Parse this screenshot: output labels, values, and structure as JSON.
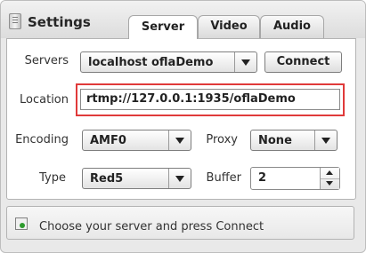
{
  "header": {
    "title": "Settings",
    "tabs": [
      {
        "label": "Server",
        "active": true
      },
      {
        "label": "Video",
        "active": false
      },
      {
        "label": "Audio",
        "active": false
      }
    ]
  },
  "form": {
    "servers_label": "Servers",
    "servers_value": "localhost oflaDemo",
    "connect_label": "Connect",
    "location_label": "Location",
    "location_value": "rtmp://127.0.0.1:1935/oflaDemo",
    "encoding_label": "Encoding",
    "encoding_value": "AMF0",
    "proxy_label": "Proxy",
    "proxy_value": "None",
    "type_label": "Type",
    "type_value": "Red5",
    "buffer_label": "Buffer",
    "buffer_value": "2"
  },
  "status": {
    "text": "Choose your server and press Connect",
    "icon": "status-light-icon"
  },
  "colors": {
    "highlight_border": "#e03a3a"
  }
}
